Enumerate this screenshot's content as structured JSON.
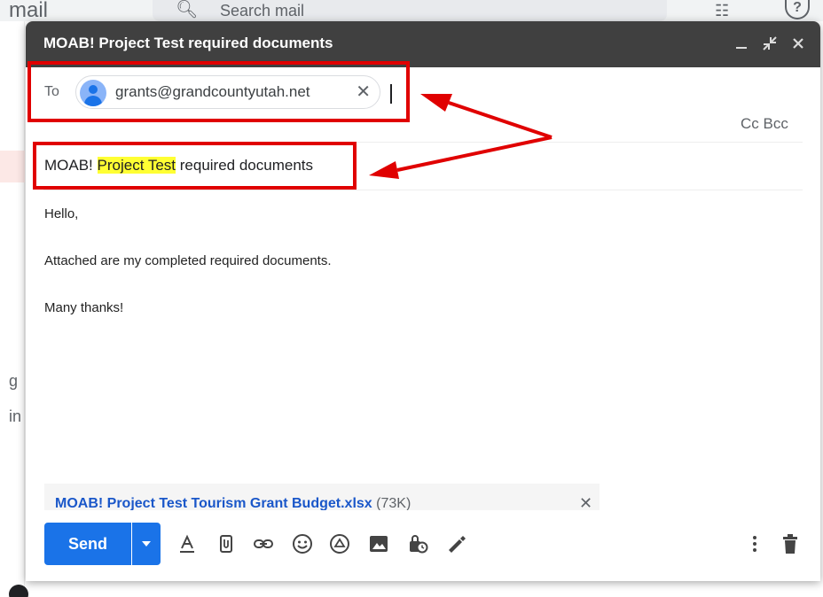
{
  "background": {
    "brand": "mail",
    "search_placeholder": "Search mail",
    "left_letters": [
      "g",
      "in"
    ],
    "icons": [
      "search-icon",
      "tune-icon",
      "help-icon"
    ]
  },
  "compose": {
    "title": "MOAB! Project Test required documents",
    "to_label": "To",
    "recipient": "grants@grandcountyutah.net",
    "cc_bcc": "Cc Bcc",
    "subject_pre": "MOAB! ",
    "subject_highlight": "Project Test",
    "subject_post": " required documents",
    "body": {
      "greeting": "Hello,",
      "line1": "Attached are my completed required documents.",
      "closing": "Many thanks!"
    },
    "attachment": {
      "name": "MOAB! Project Test Tourism Grant Budget.xlsx",
      "size": "(73K)"
    },
    "send_label": "Send",
    "toolbar_icons": [
      "format-text-icon",
      "attach-file-icon",
      "insert-link-icon",
      "emoji-icon",
      "drive-icon",
      "insert-photo-icon",
      "confidential-mode-icon",
      "signature-icon",
      "more-options-icon",
      "delete-icon"
    ],
    "colors": {
      "header": "#404040",
      "send": "#1a73e8",
      "highlight": "#ffff33",
      "annotation": "#e00000",
      "attachment_link": "#1a57c9"
    }
  }
}
